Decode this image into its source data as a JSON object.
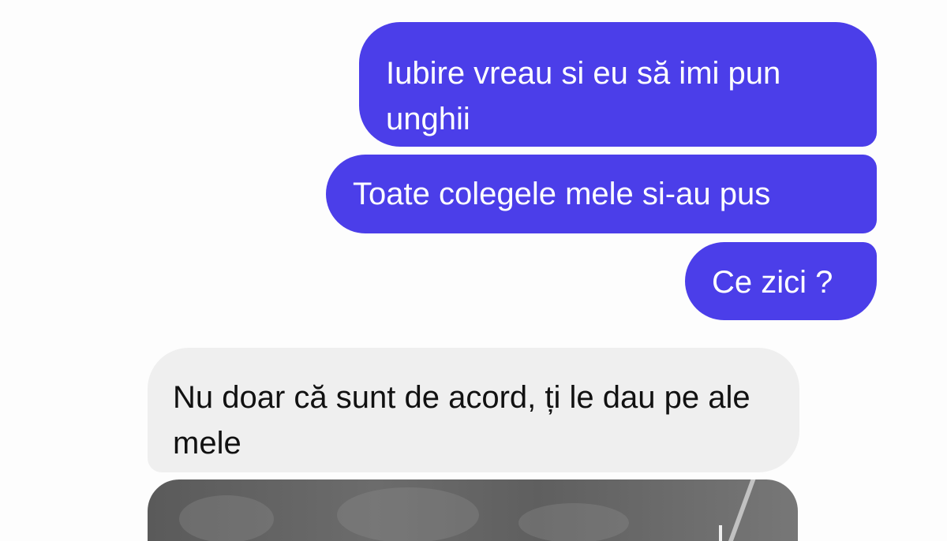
{
  "conversation": {
    "messages": [
      {
        "direction": "outgoing",
        "text": "Iubire vreau si eu să imi pun unghii"
      },
      {
        "direction": "outgoing",
        "text": "Toate colegele mele si-au pus"
      },
      {
        "direction": "outgoing",
        "text": "Ce zici ?"
      },
      {
        "direction": "incoming",
        "text": "Nu doar că sunt de acord, ți le dau pe ale mele"
      }
    ],
    "attachment": {
      "type": "photo"
    }
  },
  "colors": {
    "outgoing_bubble": "#4b3ee9",
    "incoming_bubble": "#efefef",
    "background": "#ffffff"
  }
}
